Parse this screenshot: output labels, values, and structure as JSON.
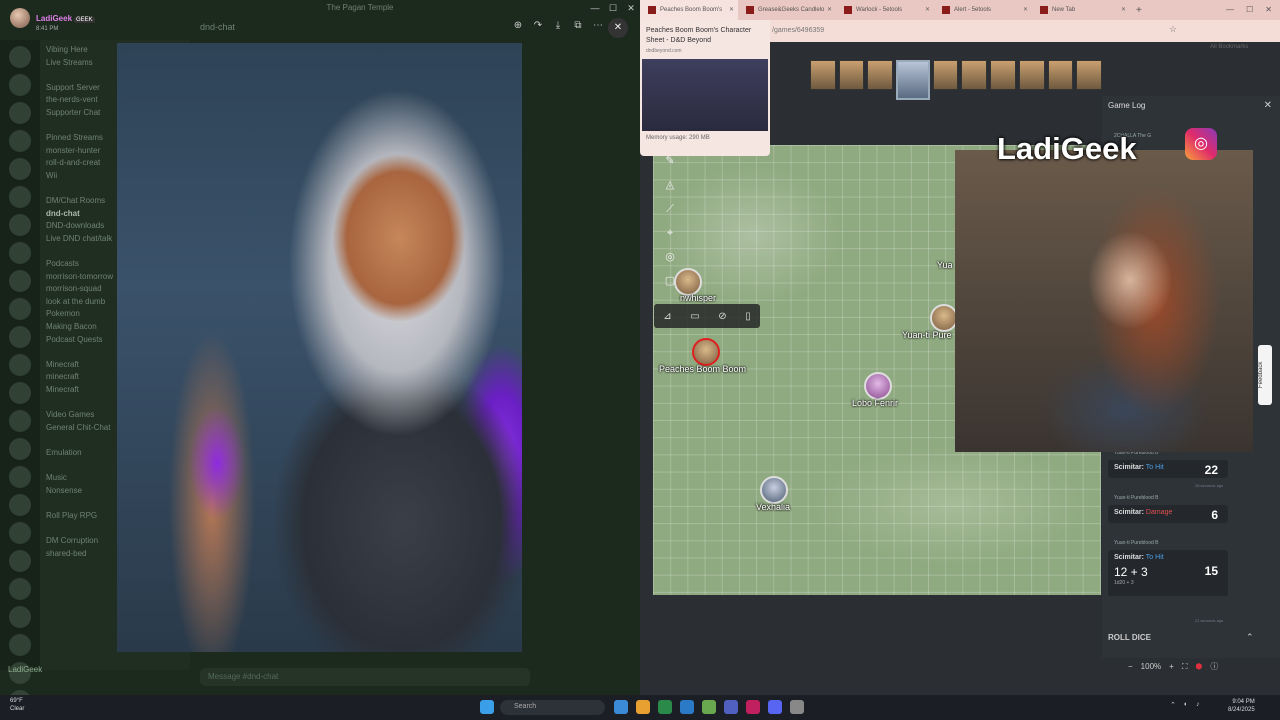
{
  "discord": {
    "user": {
      "name": "LadiGeek",
      "tag": "GEEK",
      "time": "8:41 PM"
    },
    "window_title": "The Pagan Temple",
    "channel_header": "dnd-chat",
    "channels": [
      "Vibing Here",
      "Live Streams",
      "",
      "Support Server",
      "the-nerds-vent",
      "Supporter Chat",
      "",
      "Pinned Streams",
      "monster-hunter",
      "roll-d-and-creat",
      "Wii",
      "",
      "DM/Chat Rooms",
      "dnd-chat",
      "DND-downloads",
      "Live DND chat/talk",
      "",
      "Podcasts",
      "morrison-tomorrow",
      "morrison-squad",
      "look at the dumb",
      "Pokemon",
      "Making Bacon",
      "Podcast Quests",
      "",
      "Minecraft",
      "minecraft",
      "Minecraft",
      "",
      "Video Games",
      "General Chit-Chat",
      "",
      "Emulation",
      "",
      "Music",
      "Nonsense",
      "",
      "Roll Play RPG",
      "",
      "DM Corruption",
      "shared-bed"
    ],
    "chat_placeholder": "Message #dnd-chat",
    "user_bar": "LadiGeek"
  },
  "browser": {
    "tabs": [
      {
        "label": "Peaches Boom Boom's",
        "active": true
      },
      {
        "label": "Grease&Geeks Candlelo",
        "active": false
      },
      {
        "label": "Warlock - 5etools",
        "active": false
      },
      {
        "label": "Alert - 5etools",
        "active": false
      },
      {
        "label": "New Tab",
        "active": false
      }
    ],
    "address": "/games/6496359",
    "bookmarks_label": "All Bookmarks",
    "tooltip": {
      "title": "Peaches Boom Boom's Character Sheet - D&D Beyond",
      "domain": "dndbeyond.com",
      "memory": "Memory usage: 290 MB"
    }
  },
  "vtt": {
    "tokens": [
      {
        "name": "Peaches Boom Boom",
        "style": "red"
      },
      {
        "name": "Lobo Fenrir",
        "style": "purple"
      },
      {
        "name": "Vexhalia",
        "style": "blue"
      },
      {
        "name": "Yuan-ti Pure",
        "style": "plain"
      },
      {
        "name": "nwhisper",
        "style": "plain"
      }
    ],
    "partial_label": "Yua",
    "game_log": {
      "title": "Game Log",
      "partial_header": "2CHALLA The G",
      "rolls": [
        {
          "source": "Yuan-ti Pureblood B",
          "action": "Scimitar:",
          "type": "To Hit",
          "total": "22",
          "time": "28 seconds ago"
        },
        {
          "source": "Yuan-ti Pureblood B",
          "action": "Scimitar:",
          "type": "Damage",
          "total": "6",
          "time": "28 seconds ago"
        },
        {
          "source": "Yuan-ti Pureblood B",
          "action": "Scimitar:",
          "type": "To Hit",
          "breakdown": "12 + 3",
          "formula": "1d20 + 3",
          "total": "15",
          "time": "21 seconds ago"
        }
      ]
    },
    "roll_dice": "ROLL DICE",
    "zoom": "100%",
    "feedback": "Feedback"
  },
  "stream": {
    "handle": "LadiGeek"
  },
  "taskbar": {
    "weather_temp": "69°F",
    "weather_desc": "Clear",
    "search": "Search",
    "time": "9:04 PM",
    "date": "8/24/2025"
  }
}
